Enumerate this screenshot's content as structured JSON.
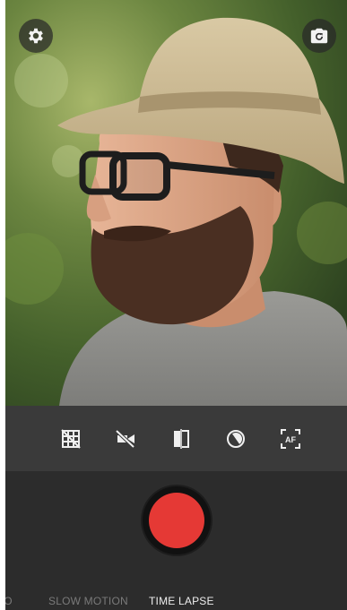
{
  "top_controls": {
    "settings_icon": "gear-icon",
    "switch_camera_icon": "camera-switch-icon"
  },
  "tools": [
    {
      "name": "grid-off-icon"
    },
    {
      "name": "flash-off-icon"
    },
    {
      "name": "mirror-icon"
    },
    {
      "name": "exposure-icon"
    },
    {
      "name": "autofocus-icon",
      "label": "AF"
    }
  ],
  "record": {
    "color": "#e53935"
  },
  "modes": {
    "video": "EO",
    "slow_motion": "SLOW MOTION",
    "time_lapse": "TIME LAPSE",
    "selected": "TIME LAPSE"
  },
  "colors": {
    "record_red": "#e53935",
    "selected_mode": "#eeeeee",
    "unselected_mode": "#7a7a7a"
  }
}
